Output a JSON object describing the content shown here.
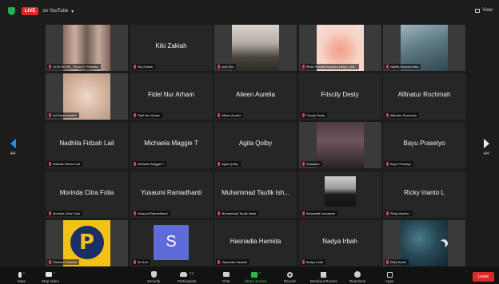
{
  "topbar": {
    "live_badge": "LIVE",
    "live_target": "on YouTube",
    "view_label": "View"
  },
  "pagination": {
    "left_page": "4/4",
    "right_page": "4/4"
  },
  "participants": [
    {
      "id": "p1",
      "name": "",
      "label": "2120780236_ Paula S. Prasetia"
    },
    {
      "id": "p2",
      "name": "Kiki Zakiah",
      "label": "Kiki Zakiah"
    },
    {
      "id": "p3",
      "name": "",
      "label": "yudi Shs"
    },
    {
      "id": "p4",
      "name": "",
      "label": "Rifda Thaniati Azzahra aditya_Inst..."
    },
    {
      "id": "p5",
      "name": "",
      "label": "Nabila Khaerunnisa"
    },
    {
      "id": "p6",
      "name": "",
      "label": "Ad Dlenaedyadhi"
    },
    {
      "id": "p7",
      "name": "Fidel Nur Arham",
      "label": "Fidel Nur Arham"
    },
    {
      "id": "p8",
      "name": "Aileen Aurelia",
      "label": "Aileen Aurelia"
    },
    {
      "id": "p9",
      "name": "Friscily Desty",
      "label": "Friscily Desty"
    },
    {
      "id": "p10",
      "name": "Alfinatur Rochmah",
      "label": "Alfinatur Rochmah"
    },
    {
      "id": "p11",
      "name": "Nadhila Fidzah Lail",
      "label": "Nadhila Fidzah Lail"
    },
    {
      "id": "p12",
      "name": "Michaela Maggie T",
      "label": "Michaela Maggie T"
    },
    {
      "id": "p13",
      "name": "Agita Qolby",
      "label": "Agita Qolby"
    },
    {
      "id": "p14",
      "name": "",
      "label": "Gunawan"
    },
    {
      "id": "p15",
      "name": "Bayu Prasetyo",
      "label": "Bayu Prasetyo"
    },
    {
      "id": "p16",
      "name": "Morinda Citra Folia",
      "label": "Morinda Citra Folia"
    },
    {
      "id": "p17",
      "name": "Yusaumi Ramadhanti",
      "label": "Yusaumi Ramadhanti"
    },
    {
      "id": "p18",
      "name": "Muhammad Taufik Ish...",
      "label": "Muhammad Taufik Ishak"
    },
    {
      "id": "p19",
      "name": "",
      "label": "Saraswati Lismawan"
    },
    {
      "id": "p20",
      "name": "Ricky Irianto L",
      "label": "Ricky Irianto L"
    },
    {
      "id": "p21",
      "name": "",
      "label": "Pamela Chandra"
    },
    {
      "id": "p22",
      "name": "",
      "label": "Sri Nuri",
      "avatar_letter": "S"
    },
    {
      "id": "p23",
      "name": "Hasnadia Hamida",
      "label": "Hasnadia Hamida"
    },
    {
      "id": "p24",
      "name": "Nadya Irbah",
      "label": "Nadya Irbah"
    },
    {
      "id": "p25",
      "name": "",
      "label": "Elisa Kamil"
    }
  ],
  "toolbar": {
    "mute": "Mute",
    "stop_video": "Stop Video",
    "security": "Security",
    "participants": "Participants",
    "participants_count": "74",
    "chat": "Chat",
    "share_screen": "Share Screen",
    "record": "Record",
    "breakout_rooms": "Breakout Rooms",
    "reactions": "Reactions",
    "apps": "Apps",
    "leave": "Leave"
  },
  "colors": {
    "live_red": "#e02828",
    "nav_arrow_blue": "#1f8fff",
    "share_green": "#2fb84a",
    "avatar_purple": "#5f6bd8"
  }
}
